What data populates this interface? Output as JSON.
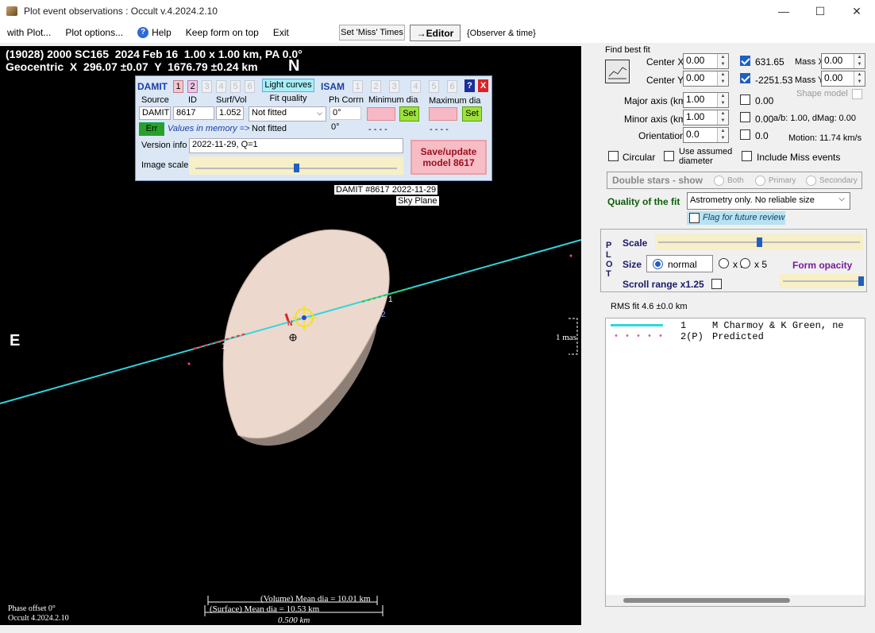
{
  "window": {
    "title": "Plot event observations : Occult v.4.2024.2.10",
    "controls": [
      "—",
      "☐",
      "✕"
    ]
  },
  "menu": {
    "with_plot": "with Plot...",
    "plot_options": "Plot options...",
    "help": "Help",
    "keep_on_top": "Keep form on top",
    "exit": "Exit",
    "set_miss_times": "Set 'Miss' Times",
    "editor": "→Editor",
    "observer_time": "{Observer & time}"
  },
  "plot": {
    "header_line1": "(19028) 2000 SC165  2024 Feb 16  1.00 x 1.00 km, PA 0.0°",
    "header_line2": "Geocentric  X  296.07 ±0.07  Y  1676.79 ±0.24 km",
    "north": "N",
    "east": "E",
    "damit_label": "DAMIT #8617 2022-11-29",
    "sky_plane": "Sky Plane",
    "chord1_left": "1",
    "chord1_right": "1",
    "chord2_right": "2",
    "center_n": "N",
    "mas_label": "1 mas",
    "phase_offset": "Phase offset 0°",
    "occult_version": "Occult 4.2024.2.10",
    "volume_dia": "(Volume) Mean dia = 10.01 km",
    "surface_dia": "(Surface) Mean dia = 10.53 km",
    "scale_km": "0.500 km",
    "colors": {
      "chord_line": "#2fd6e0",
      "shape_fill": "#ecd8cc",
      "miss_dot": "#ff4d6a"
    }
  },
  "damit": {
    "damit_label": "DAMIT",
    "damit_models": [
      "1",
      "2",
      "3",
      "4",
      "5",
      "6"
    ],
    "light_curves": "Light curves",
    "isam_label": "ISAM",
    "isam_models": [
      "1",
      "2",
      "3",
      "4",
      "5",
      "6"
    ],
    "help_btn": "?",
    "close_btn": "X",
    "col_source": "Source",
    "col_id": "ID",
    "col_surf_vol": "Surf/Vol",
    "col_fit_quality": "Fit quality",
    "col_ph_corrn": "Ph Corrn",
    "col_min_dia": "Minimum dia",
    "col_max_dia": "Maximum dia",
    "source_value": "DAMIT",
    "id_value": "8617",
    "surf_vol_value": "1.052",
    "fit_quality_value": "Not fitted",
    "ph_corrn_value": "0°",
    "set": "Set",
    "err": "Err",
    "values_in_memory": "Values in memory =>",
    "memory_fit": "Not fitted",
    "memory_ph": "0°",
    "memory_min": "- - - -",
    "memory_max": "- - - -",
    "version_info_label": "Version info",
    "version_info_value": "2022-11-29, Q=1",
    "image_scale_label": "Image scale",
    "save_update": "Save/update model 8617",
    "image_scale_level": 0.5
  },
  "fit": {
    "find_best_fit": "Find best fit",
    "center_x_label": "Center X",
    "center_x_value": "0.00",
    "center_y_label": "Center Y",
    "center_y_value": "0.00",
    "cx_result": "631.65",
    "cy_result": "-2251.53",
    "mass_x_label": "Mass X",
    "mass_x_value": "0.00",
    "mass_y_label": "Mass Y",
    "mass_y_value": "0.00",
    "major_axis_label": "Major axis (km)",
    "major_axis_value": "1.00",
    "major_result": "0.00",
    "minor_axis_label": "Minor axis (km)",
    "minor_axis_value": "1.00",
    "minor_result": "0.00",
    "orientation_label": "Orientation",
    "orientation_value": "0.0",
    "orientation_result": "0.0",
    "shape_model": "Shape model",
    "ab_dmag": "a/b: 1.00, dMag: 0.00",
    "motion": "Motion: 11.74 km/s",
    "circular": "Circular",
    "use_assumed_diameter": "Use assumed diameter",
    "include_miss": "Include Miss events",
    "double_stars_show": "Double stars - show",
    "ds_both": "Both",
    "ds_primary": "Primary",
    "ds_secondary": "Secondary",
    "quality_label": "Quality of the fit",
    "quality_value": "Astrometry only. No reliable size",
    "flag_review": "Flag for future review"
  },
  "plot_panel": {
    "plot_vertical": [
      "P",
      "L",
      "O",
      "T"
    ],
    "scale_label": "Scale",
    "scale_level": 0.5,
    "size_label": "Size",
    "size_normal": "normal",
    "size_x2": "x 2",
    "size_x5": "x 5",
    "form_opacity": "Form opacity",
    "form_opacity_level": 1.0,
    "scroll_range": "Scroll range x1.25"
  },
  "results": {
    "rms_fit": "RMS fit 4.6 ±0.0 km",
    "rows": [
      {
        "num": "1",
        "name": "M Charmoy & K Green, ne"
      },
      {
        "num": "2(P)",
        "name": "Predicted"
      }
    ]
  }
}
